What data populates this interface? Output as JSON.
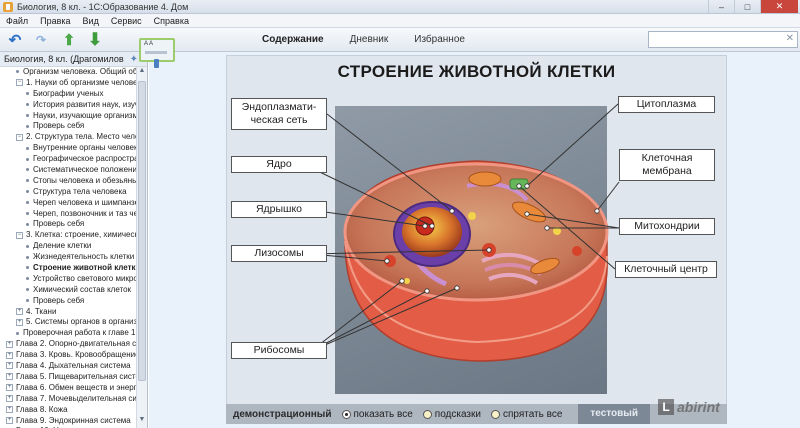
{
  "window": {
    "title": "Биология, 8 кл. - 1С:Образование 4. Дом",
    "buttons": [
      "‒",
      "□",
      "✕"
    ]
  },
  "menu": [
    "Файл",
    "Правка",
    "Вид",
    "Сервис",
    "Справка"
  ],
  "toolbar": {
    "tabs": [
      {
        "label": "Содержание",
        "active": true
      },
      {
        "label": "Дневник",
        "active": false
      },
      {
        "label": "Избранное",
        "active": false
      }
    ],
    "search": {
      "value": "",
      "placeholder": ""
    }
  },
  "sidebar": {
    "header": "Биология, 8 кл. (Драгомилов",
    "items": [
      {
        "text": "Организм человека. Общий об",
        "indent": 1,
        "kind": "dot"
      },
      {
        "text": "1. Науки об организме человек",
        "indent": 1,
        "kind": "minus"
      },
      {
        "text": "Биографии ученых",
        "indent": 2,
        "kind": "dot"
      },
      {
        "text": "История развития наук, изуч",
        "indent": 2,
        "kind": "dot"
      },
      {
        "text": "Науки, изучающие организм",
        "indent": 2,
        "kind": "dot"
      },
      {
        "text": "Проверь себя",
        "indent": 2,
        "kind": "dot"
      },
      {
        "text": "2. Структура тела. Место челов",
        "indent": 1,
        "kind": "minus"
      },
      {
        "text": "Внутренние органы человека",
        "indent": 2,
        "kind": "dot"
      },
      {
        "text": "Географическое распростран",
        "indent": 2,
        "kind": "dot"
      },
      {
        "text": "Систематическое положение",
        "indent": 2,
        "kind": "dot"
      },
      {
        "text": "Стопы человека и обезьяны",
        "indent": 2,
        "kind": "dot"
      },
      {
        "text": "Структура тела человека",
        "indent": 2,
        "kind": "dot"
      },
      {
        "text": "Череп человека и шимпанзе",
        "indent": 2,
        "kind": "dot"
      },
      {
        "text": "Череп, позвоночник и таз че",
        "indent": 2,
        "kind": "dot"
      },
      {
        "text": "Проверь себя",
        "indent": 2,
        "kind": "dot"
      },
      {
        "text": "3. Клетка: строение, химическ",
        "indent": 1,
        "kind": "minus"
      },
      {
        "text": "Деление клетки",
        "indent": 2,
        "kind": "dot"
      },
      {
        "text": "Жизнедеятельность клетки",
        "indent": 2,
        "kind": "dot"
      },
      {
        "text": "Строение животной клетки",
        "indent": 2,
        "kind": "dot",
        "bold": true
      },
      {
        "text": "Устройство светового микро",
        "indent": 2,
        "kind": "dot"
      },
      {
        "text": "Химический состав клеток",
        "indent": 2,
        "kind": "dot"
      },
      {
        "text": "Проверь себя",
        "indent": 2,
        "kind": "dot"
      },
      {
        "text": "4. Ткани",
        "indent": 1,
        "kind": "plus"
      },
      {
        "text": "5. Системы органов в организм",
        "indent": 1,
        "kind": "plus"
      },
      {
        "text": "Проверочная работа к главе 1 (",
        "indent": 1,
        "kind": "dot"
      },
      {
        "text": "Глава 2. Опорно-двигательная си",
        "indent": 0,
        "kind": "plus"
      },
      {
        "text": "Глава 3. Кровь. Кровообращение",
        "indent": 0,
        "kind": "plus"
      },
      {
        "text": "Глава 4. Дыхательная система",
        "indent": 0,
        "kind": "plus"
      },
      {
        "text": "Глава 5. Пищеварительная систе",
        "indent": 0,
        "kind": "plus"
      },
      {
        "text": "Глава 6. Обмен веществ и энерги",
        "indent": 0,
        "kind": "plus"
      },
      {
        "text": "Глава 7. Мочевыделительная сис",
        "indent": 0,
        "kind": "plus"
      },
      {
        "text": "Глава 8. Кожа",
        "indent": 0,
        "kind": "plus"
      },
      {
        "text": "Глава 9. Эндокринная система",
        "indent": 0,
        "kind": "plus"
      },
      {
        "text": "Глава 10. Нервная система",
        "indent": 0,
        "kind": "plus"
      },
      {
        "text": "Глава 11. Органы чувств. Анализа",
        "indent": 0,
        "kind": "plus"
      }
    ]
  },
  "slide": {
    "title": "СТРОЕНИЕ ЖИВОТНОЙ КЛЕТКИ",
    "labels": {
      "er": "Эндоплазмати-\nческая сеть",
      "nucleus": "Ядро",
      "nucleolus": "Ядрышко",
      "lysosomes": "Лизосомы",
      "ribosomes": "Рибосомы",
      "cytoplasm": "Цитоплазма",
      "membrane": "Клеточная\nмембрана",
      "mitochondria": "Митохондрии",
      "centrosome": "Клеточный центр"
    }
  },
  "modebar": {
    "left": "демонстрационный",
    "options": [
      {
        "label": "показать все",
        "selected": true
      },
      {
        "label": "подсказки",
        "selected": false
      },
      {
        "label": "спрятать все",
        "selected": false
      }
    ],
    "right": "тестовый"
  },
  "watermark": {
    "badge": "L",
    "text": "abirint"
  },
  "colors": {
    "accent": "#2c73c6",
    "membrane": "#e35c46",
    "highlight": "#9ccc6b"
  }
}
